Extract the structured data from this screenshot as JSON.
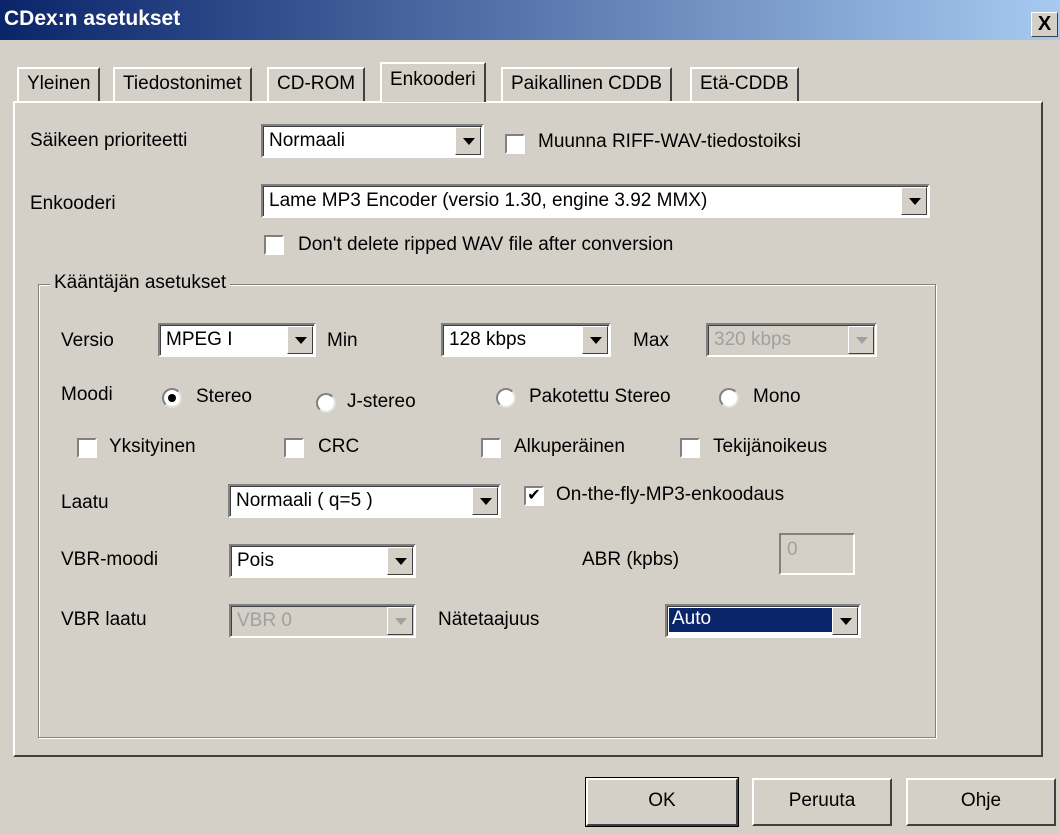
{
  "window": {
    "title": "CDex:n asetukset",
    "close_label": "X"
  },
  "tabs": [
    {
      "label": "Yleinen"
    },
    {
      "label": "Tiedostonimet"
    },
    {
      "label": "CD-ROM"
    },
    {
      "label": "Enkooderi",
      "active": true
    },
    {
      "label": "Paikallinen CDDB"
    },
    {
      "label": "Etä-CDDB"
    }
  ],
  "thread_priority": {
    "label": "Säikeen prioriteetti",
    "value": "Normaali"
  },
  "riff_wav": {
    "label": "Muunna RIFF-WAV-tiedostoiksi",
    "checked": false
  },
  "encoder": {
    "label": "Enkooderi",
    "value": "Lame MP3 Encoder (versio 1.30, engine 3.92 MMX)"
  },
  "keep_wav": {
    "label": "Don't delete ripped WAV file after conversion",
    "checked": false
  },
  "group": {
    "title": "Kääntäjän asetukset",
    "version": {
      "label": "Versio",
      "value": "MPEG I"
    },
    "min": {
      "label": "Min",
      "value": "128 kbps"
    },
    "max": {
      "label": "Max",
      "value": "320 kbps",
      "disabled": true
    },
    "mode": {
      "label": "Moodi",
      "options": [
        "Stereo",
        "J-stereo",
        "Pakotettu Stereo",
        "Mono"
      ],
      "selected": "Stereo"
    },
    "flags": {
      "private": {
        "label": "Yksityinen",
        "checked": false
      },
      "crc": {
        "label": "CRC",
        "checked": false
      },
      "original": {
        "label": "Alkuperäinen",
        "checked": false
      },
      "copyright": {
        "label": "Tekijänoikeus",
        "checked": false
      }
    },
    "quality": {
      "label": "Laatu",
      "value": "Normaali ( q=5 )"
    },
    "on_the_fly": {
      "label": "On-the-fly-MP3-enkoodaus",
      "checked": true,
      "mark": "✔"
    },
    "vbr_mode": {
      "label": "VBR-moodi",
      "value": "Pois"
    },
    "abr": {
      "label": "ABR (kpbs)",
      "value": "0"
    },
    "vbr_quality": {
      "label": "VBR laatu",
      "value": "VBR 0",
      "disabled": true
    },
    "sample_rate": {
      "label": "Nätetaajuus",
      "value": "Auto"
    }
  },
  "buttons": {
    "ok": "OK",
    "cancel": "Peruuta",
    "help": "Ohje"
  },
  "colors": {
    "face": "#d4d0c8",
    "titlebar": "#0a246a",
    "selection": "#0a246a"
  }
}
